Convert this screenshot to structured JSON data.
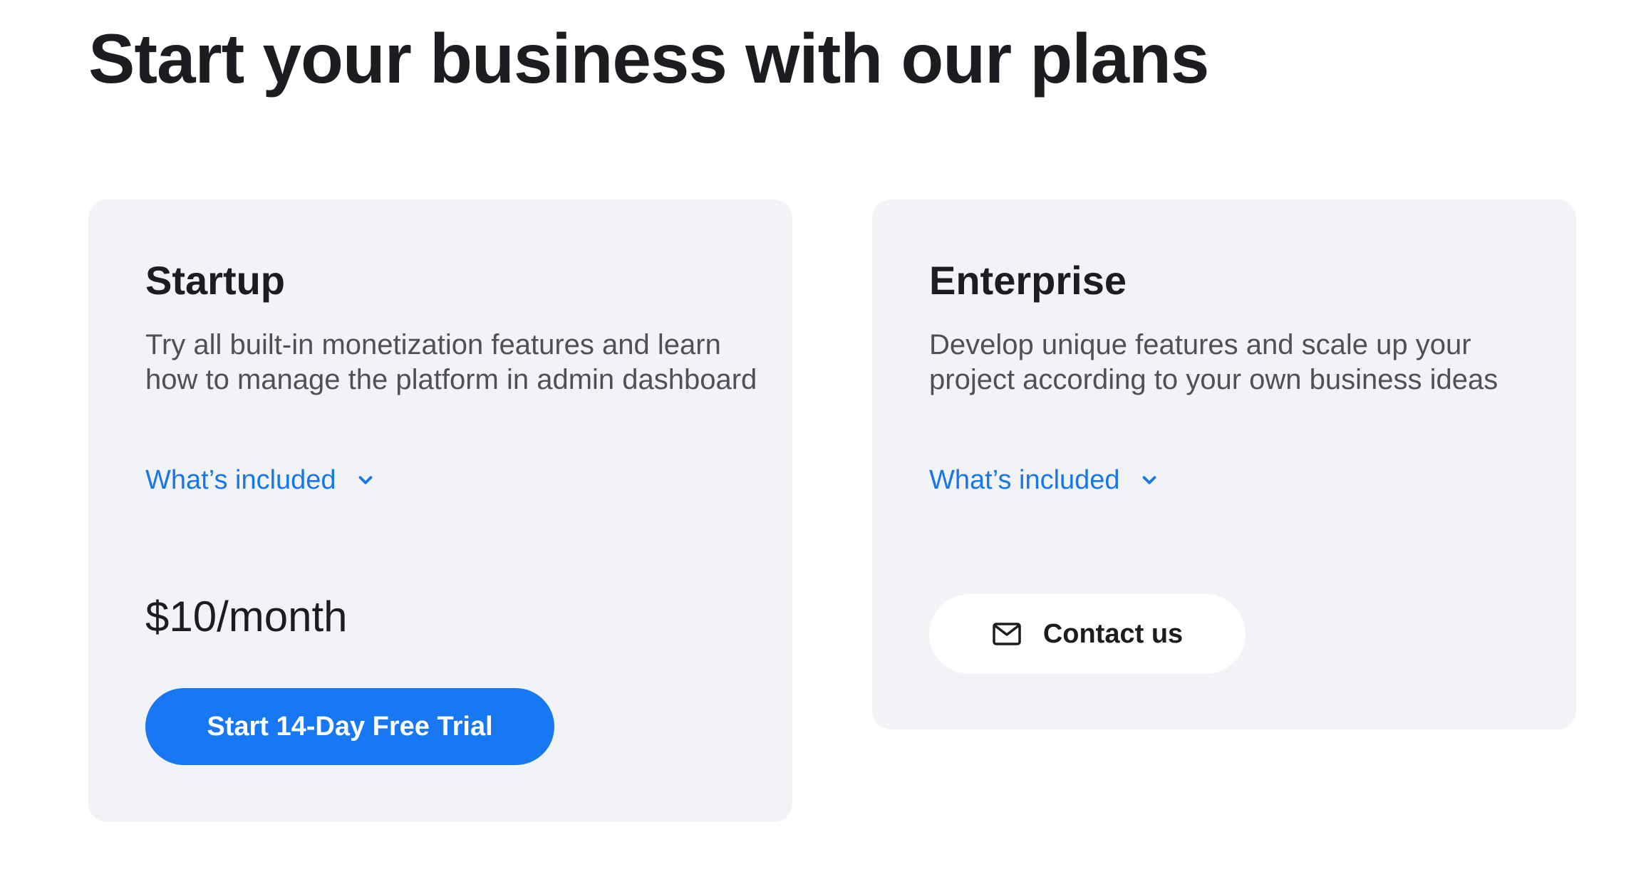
{
  "header": {
    "title": "Start your business with our plans"
  },
  "plans": [
    {
      "name": "Startup",
      "description": "Try all built-in monetization features and learn how to manage the platform in admin dashboard",
      "included_label": "What’s included",
      "price": "$10/month",
      "cta_label": "Start 14-Day Free Trial",
      "cta_icon": "none"
    },
    {
      "name": "Enterprise",
      "description": "Develop unique features and scale up your project according to your own business ideas",
      "included_label": "What’s included",
      "cta_label": "Contact us",
      "cta_icon": "mail-icon"
    }
  ],
  "colors": {
    "accent": "#1877f2",
    "link": "#1877e8",
    "card_background": "#f2f3f6",
    "title_text": "#1c1d21",
    "body_text": "#4f5058"
  }
}
